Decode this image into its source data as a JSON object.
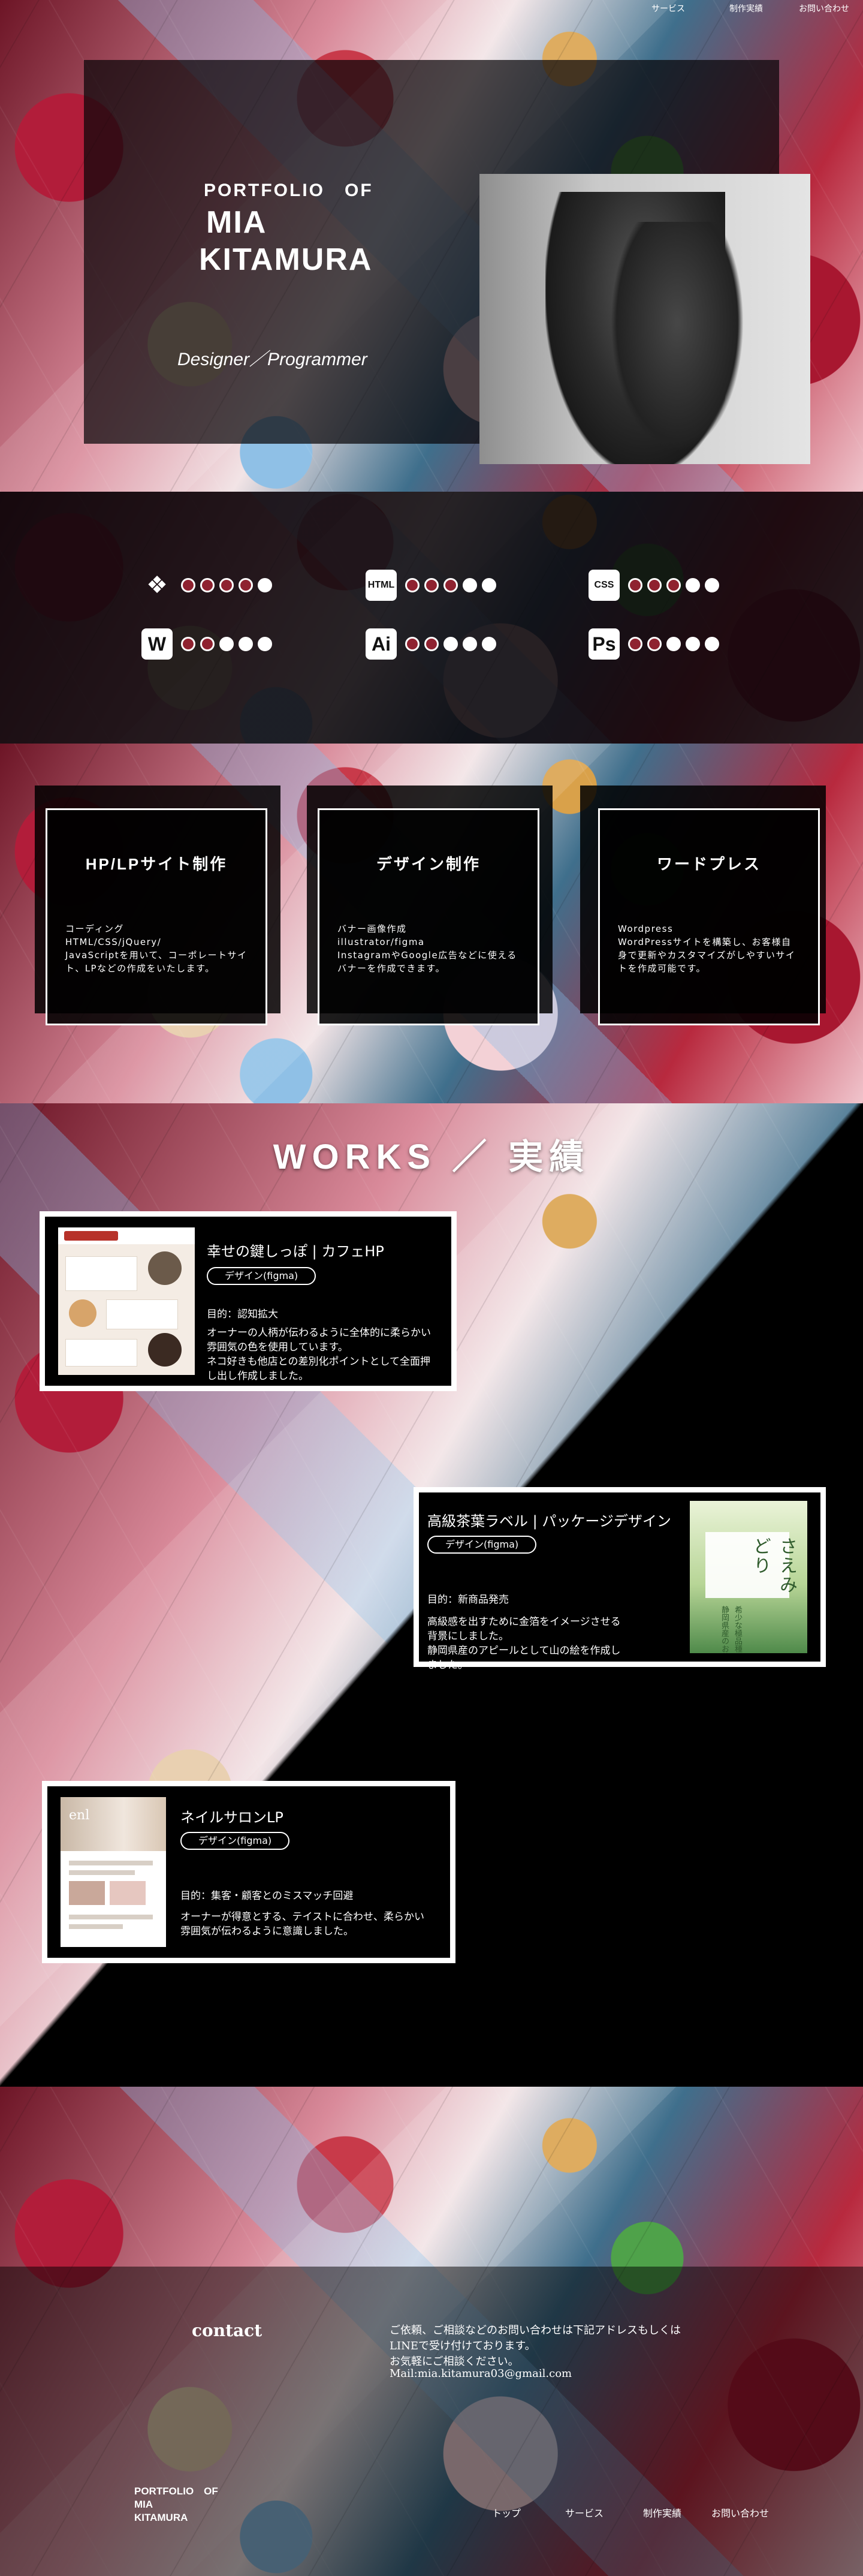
{
  "nav": {
    "items": [
      "サービス",
      "制作実績",
      "お問い合わせ"
    ]
  },
  "hero": {
    "portfolio_label": "PORTFOLIO　OF",
    "name_line1": "MIA",
    "name_line2": "KITAMURA",
    "role": "Designer／Programmer"
  },
  "skills": [
    {
      "icon": "figma-icon",
      "glyph": "❖",
      "name": "figma",
      "level": 4
    },
    {
      "icon": "html-icon",
      "glyph": "HTML",
      "name": "HTML",
      "level": 3
    },
    {
      "icon": "css-icon",
      "glyph": "CSS",
      "name": "CSS",
      "level": 3
    },
    {
      "icon": "wordpress-icon",
      "glyph": "W",
      "name": "WordPress",
      "level": 2
    },
    {
      "icon": "illustrator-icon",
      "glyph": "Ai",
      "name": "Illustrator",
      "level": 2
    },
    {
      "icon": "photoshop-icon",
      "glyph": "Ps",
      "name": "Photoshop",
      "level": 2
    }
  ],
  "skill_max": 5,
  "services": [
    {
      "title": "HP/LPサイト制作",
      "body": "コーディング\nHTML/CSS/jQuery/\nJavaScriptを用いて、コーポレートサイト、LPなどの作成をいたします。"
    },
    {
      "title": "デザイン制作",
      "body": "バナー画像作成\nillustrator/figma\nInstagramやGoogle広告などに使えるバナーを作成できます。"
    },
    {
      "title": "ワードプレス",
      "body": "Wordpress\nWordPressサイトを構築し、お客様自身で更新やカスタマイズがしやすいサイトを作成可能です。"
    }
  ],
  "works": {
    "title": "WORKS ／ 実績",
    "items": [
      {
        "name": "幸せの鍵しっぽ | カフェHP",
        "tag": "デザイン(figma)",
        "goal": "目的：認知拡大",
        "desc": "オーナーの人柄が伝わるように全体的に柔らかい雰囲気の色を使用しています。\nネコ好きも他店との差別化ポイントとして全面押し出し作成しました。"
      },
      {
        "name": "高級茶葉ラベル | パッケージデザイン",
        "tag": "デザイン(figma)",
        "goal": "目的：新商品発売",
        "desc": "高級感を出すために金箔をイメージさせる背景にしました。\n静岡県産のアピールとして山の絵を作成しました。",
        "thumb_title": "さえみどり",
        "thumb_sub": "希少な極品種",
        "thumb_sub2": "静岡県産のお茶"
      },
      {
        "name": "ネイルサロンLP",
        "tag": "デザイン(figma)",
        "goal": "目的：集客・顧客とのミスマッチ回避",
        "desc": "オーナーが得意とする、テイストに合わせ、柔らかい雰囲気が伝わるように意識しました。",
        "thumb_brand": "enl"
      }
    ]
  },
  "contact": {
    "heading": "contact",
    "text": "ご依頼、ご相談などのお問い合わせは下記アドレスもしくはLINEで受け付けております。\nお気軽にご相談ください。",
    "mail": "Mail:mia.kitamura03@gmail.com"
  },
  "footer": {
    "logo": "PORTFOLIO　OF\nMIA\nKITAMURA",
    "nav": [
      "トップ",
      "サービス",
      "制作実績",
      "お問い合わせ"
    ]
  }
}
